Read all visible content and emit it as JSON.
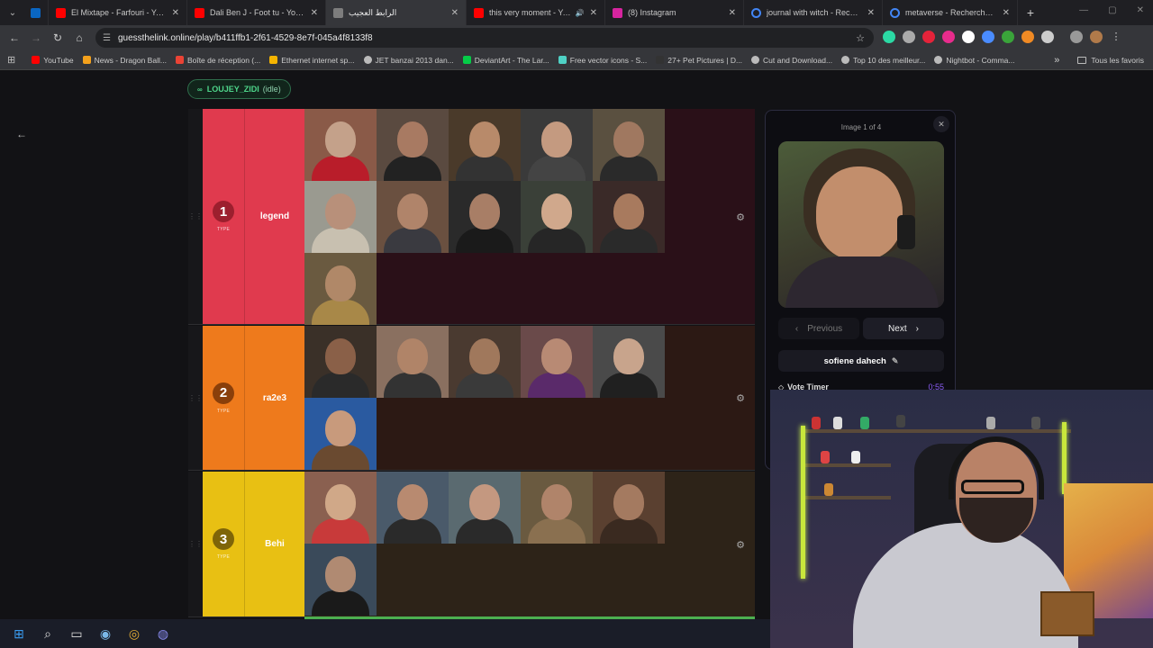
{
  "browser": {
    "tabs": [
      {
        "title": "El Mixtape - Farfouri - YouTub",
        "favicon": "youtube-icon",
        "color": "#ff0000",
        "active": false,
        "extra": ""
      },
      {
        "title": "Dali Ben J - Foot tu - YouTube",
        "favicon": "youtube-icon",
        "color": "#ff0000",
        "active": false,
        "extra": ""
      },
      {
        "title": "الرابط العجيب",
        "favicon": "guessthelink-icon",
        "color": "#7d7d7d",
        "active": true,
        "extra": ""
      },
      {
        "title": "this very moment - YouTu",
        "favicon": "youtube-icon",
        "color": "#ff0000",
        "active": false,
        "extra": "🔊"
      },
      {
        "title": "(8) Instagram",
        "favicon": "instagram-icon",
        "color": "#d6249f",
        "active": false,
        "extra": ""
      },
      {
        "title": "journal with witch - Recherch",
        "favicon": "google-icon",
        "color": "#ffffff",
        "active": false,
        "extra": ""
      },
      {
        "title": "metaverse - Recherche Googl",
        "favicon": "google-icon",
        "color": "#ffffff",
        "active": false,
        "extra": ""
      }
    ],
    "url": "guessthelink.online/play/b411ffb1-2f61-4529-8e7f-045a4f8133f8",
    "bookmarks": [
      {
        "label": "YouTube",
        "color": "#ff0000"
      },
      {
        "label": "News - Dragon Ball...",
        "color": "#f4a11c"
      },
      {
        "label": "Boîte de réception (...",
        "color": "#ea4335"
      },
      {
        "label": "Ethernet internet sp...",
        "color": "#f4b400"
      },
      {
        "label": "JET banzai 2013 dan...",
        "color": "#bbbbbb"
      },
      {
        "label": "DeviantArt - The Lar...",
        "color": "#05cc47"
      },
      {
        "label": "Free vector icons - S...",
        "color": "#4fd1c5"
      },
      {
        "label": "27+ Pet Pictures | D...",
        "color": "#333333"
      },
      {
        "label": "Cut and Download...",
        "color": "#bbbbbb"
      },
      {
        "label": "Top 10 des meilleur...",
        "color": "#bbbbbb"
      },
      {
        "label": "Nightbot - Comma...",
        "color": "#bbbbbb"
      }
    ],
    "bookmarks_overflow": "»",
    "all_bookmarks": "Tous les favoris"
  },
  "game": {
    "user": {
      "name": "LOUJEY_ZIDI",
      "status": "(idle)"
    },
    "tiers": [
      {
        "number": "1",
        "type": "TYPE",
        "name": "legend",
        "color": "#e03a4e",
        "badge_color": "#9c1f2e",
        "fill": "#2a1018",
        "image_count": 11
      },
      {
        "number": "2",
        "type": "TYPE",
        "name": "ra2e3",
        "color": "#ee7a1c",
        "badge_color": "#8a3f0a",
        "fill": "#2c1914",
        "image_count": 6
      },
      {
        "number": "3",
        "type": "TYPE",
        "name": "Behi",
        "color": "#e8c013",
        "badge_color": "#7e6508",
        "fill": "#2d2318",
        "image_count": 6
      }
    ],
    "panel": {
      "counter": "Image 1 of 4",
      "previous": "Previous",
      "next": "Next",
      "voter": "sofiene dahech",
      "timer_label": "Vote Timer",
      "timer_value": "0:55"
    }
  }
}
